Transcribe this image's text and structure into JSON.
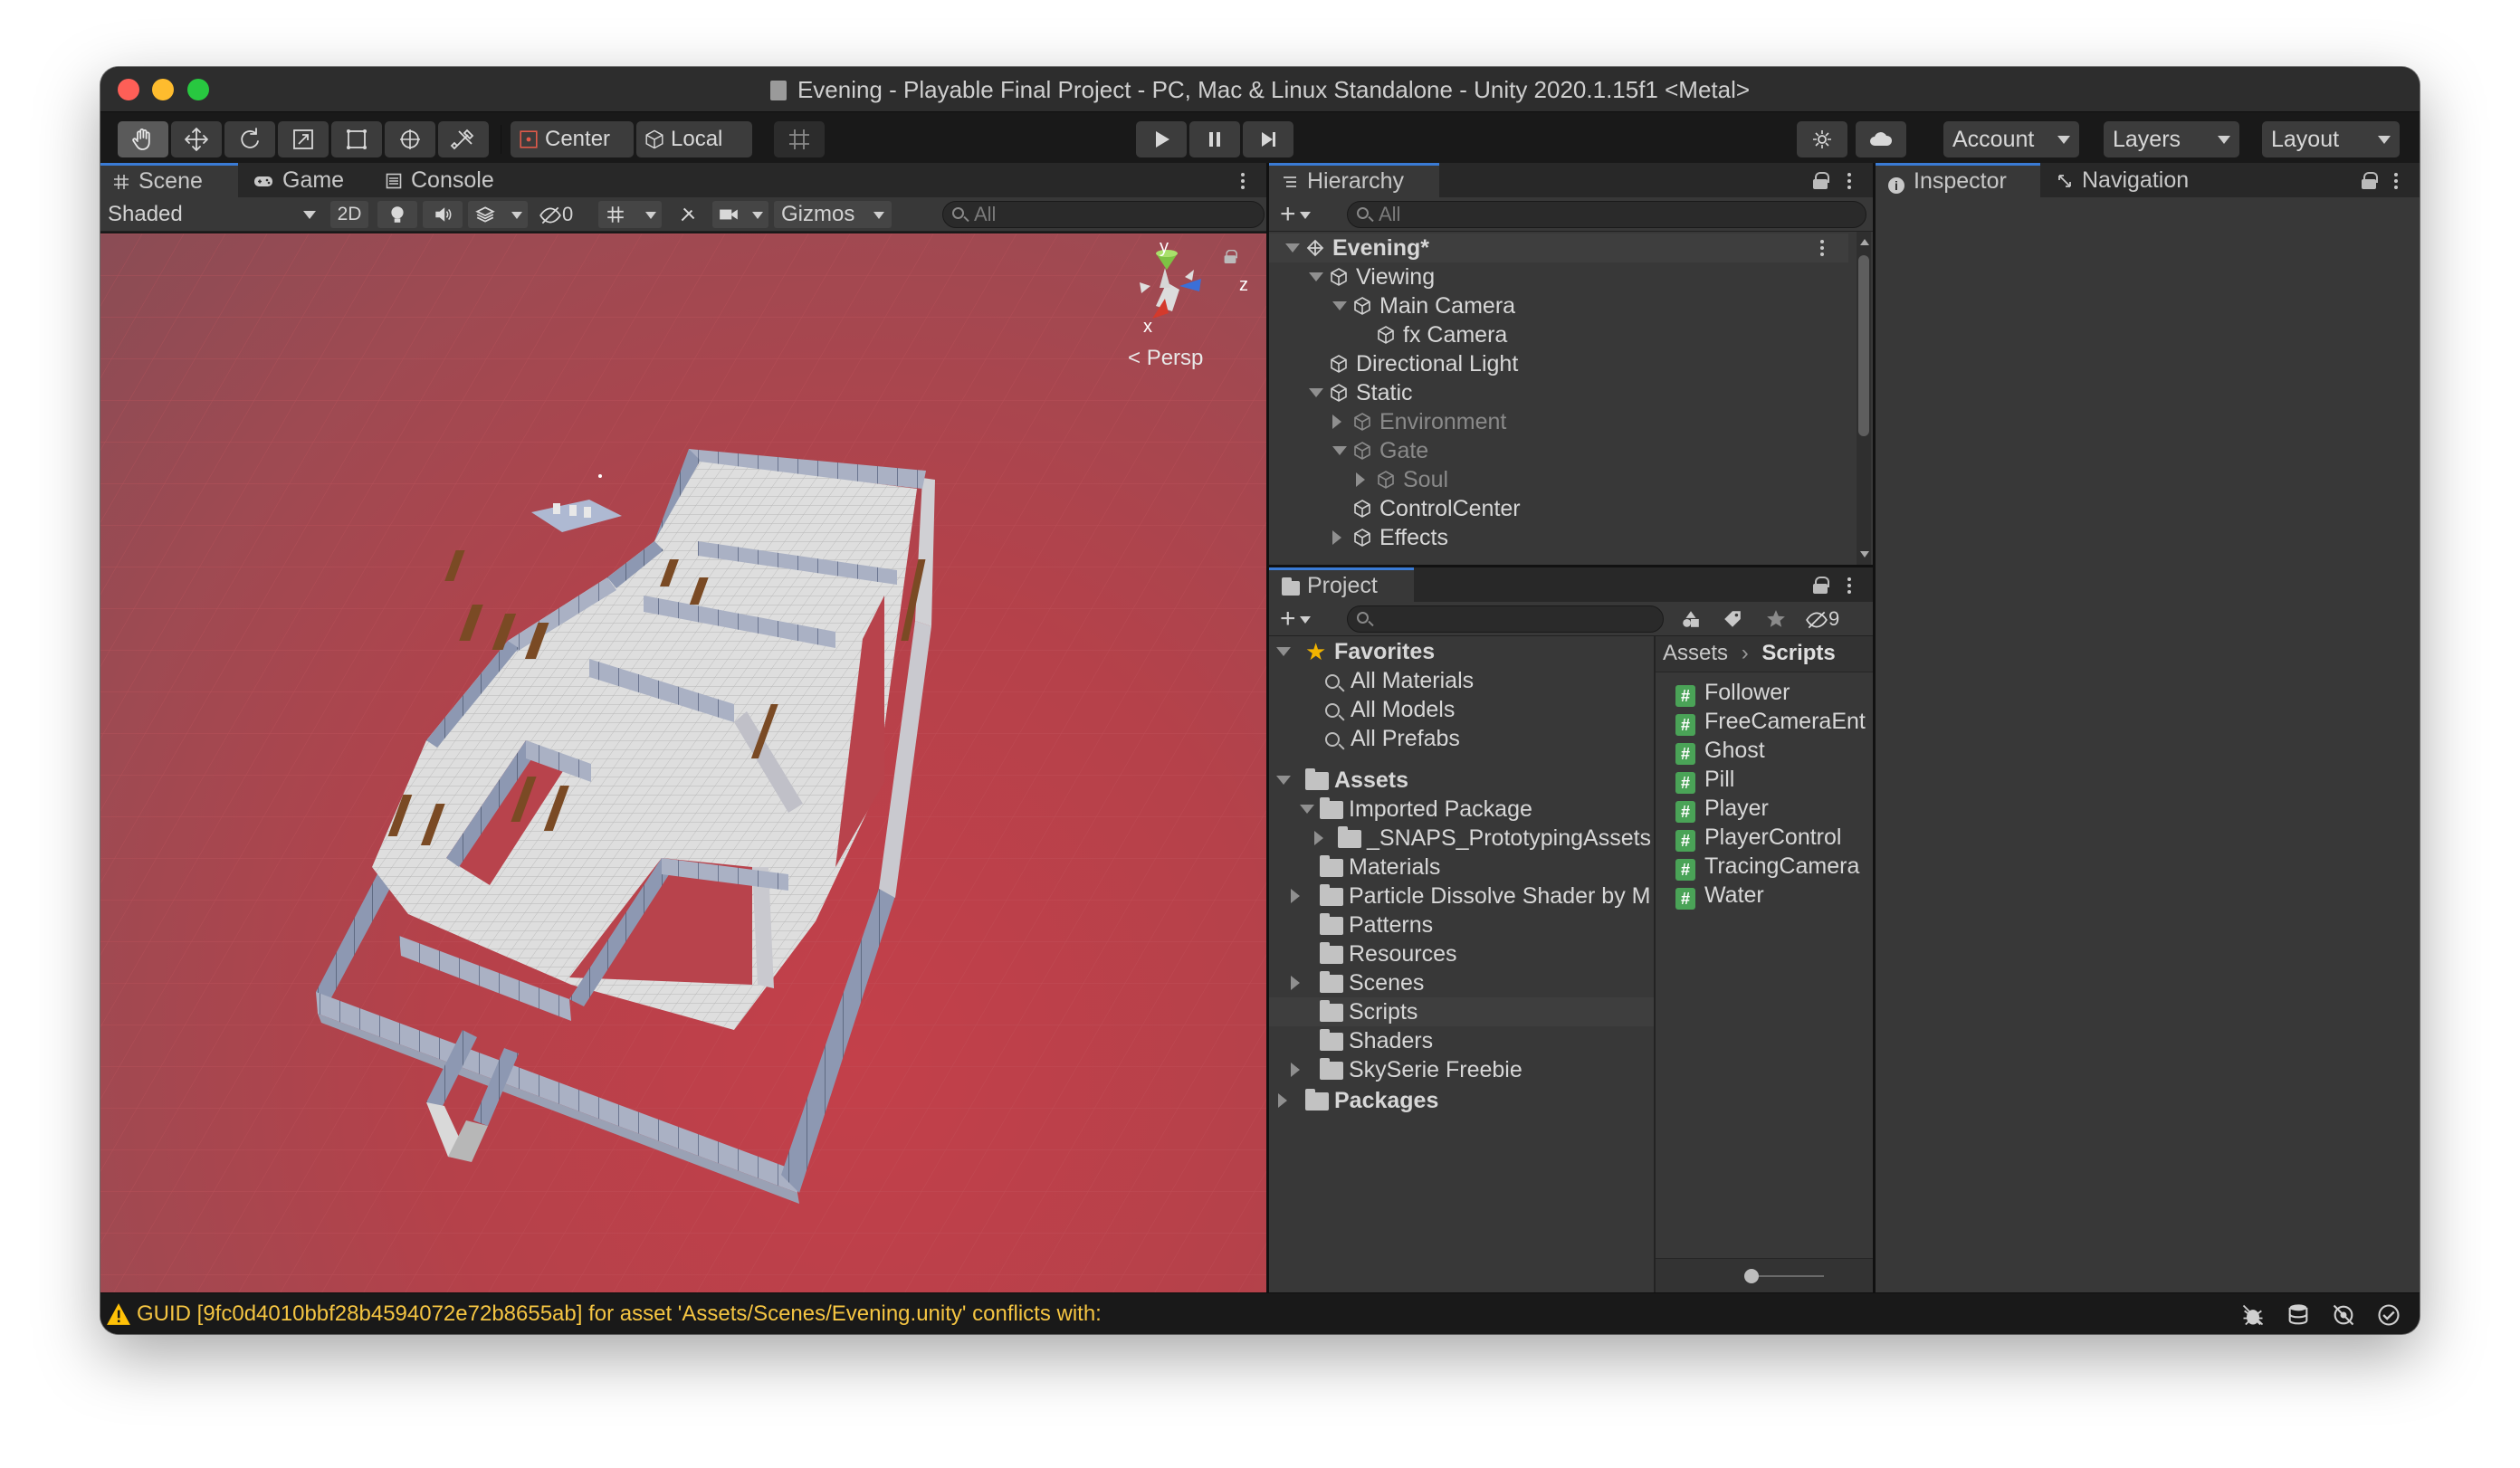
{
  "window": {
    "title": "Evening - Playable Final Project - PC, Mac & Linux Standalone - Unity 2020.1.15f1 <Metal>"
  },
  "colors": {
    "close": "#fe5f57",
    "minimize": "#febc2e",
    "zoom": "#28c840",
    "accent": "#3a7bd5",
    "selection": "#3e3e3e",
    "warning": "#ffc107",
    "scene_floor": "#b5414a"
  },
  "toolbar": {
    "tools": [
      "hand-tool",
      "move-tool",
      "rotate-tool",
      "scale-tool",
      "rect-tool",
      "transform-tool",
      "custom-tool"
    ],
    "pivot_label": "Center",
    "space_label": "Local",
    "play_controls": [
      "play",
      "pause",
      "step"
    ],
    "account_label": "Account",
    "layers_label": "Layers",
    "layout_label": "Layout"
  },
  "scene_panel": {
    "tabs": [
      {
        "label": "Scene",
        "icon": "grid-icon",
        "active": true
      },
      {
        "label": "Game",
        "icon": "gamepad-icon",
        "active": false
      },
      {
        "label": "Console",
        "icon": "console-icon",
        "active": false
      }
    ],
    "draw_mode": "Shaded",
    "mode_2d": "2D",
    "hidden_count": "0",
    "gizmos_label": "Gizmos",
    "search_placeholder": "All",
    "gizmo": {
      "y": "y",
      "z": "z",
      "x": "x",
      "projection": "Persp"
    }
  },
  "hierarchy": {
    "tab_label": "Hierarchy",
    "search_placeholder": "All",
    "items": [
      {
        "label": "Evening*",
        "depth": 0,
        "expanded": true,
        "type": "scene",
        "selected": true
      },
      {
        "label": "Viewing",
        "depth": 1,
        "expanded": true,
        "type": "object"
      },
      {
        "label": "Main Camera",
        "depth": 2,
        "expanded": true,
        "type": "object"
      },
      {
        "label": "fx Camera",
        "depth": 3,
        "type": "object"
      },
      {
        "label": "Directional Light",
        "depth": 1,
        "type": "object"
      },
      {
        "label": "Static",
        "depth": 1,
        "expanded": true,
        "type": "object"
      },
      {
        "label": "Environment",
        "depth": 2,
        "expanded": false,
        "type": "object",
        "disabled": true
      },
      {
        "label": "Gate",
        "depth": 2,
        "expanded": true,
        "type": "object",
        "disabled": true
      },
      {
        "label": "Soul",
        "depth": 3,
        "expanded": false,
        "type": "object",
        "disabled": true
      },
      {
        "label": "ControlCenter",
        "depth": 2,
        "type": "object"
      },
      {
        "label": "Effects",
        "depth": 2,
        "expanded": false,
        "type": "object"
      }
    ]
  },
  "project": {
    "tab_label": "Project",
    "hidden_count": "9",
    "favorites_label": "Favorites",
    "favorites": [
      "All Materials",
      "All Models",
      "All Prefabs"
    ],
    "assets_label": "Assets",
    "imported_package_label": "Imported Package",
    "tree": [
      {
        "label": "_SNAPS_PrototypingAssets",
        "depth": 2,
        "expandable": true
      },
      {
        "label": "Materials",
        "depth": 1,
        "expandable": false
      },
      {
        "label": "Particle Dissolve Shader by M",
        "depth": 1,
        "expandable": true
      },
      {
        "label": "Patterns",
        "depth": 1,
        "expandable": false
      },
      {
        "label": "Resources",
        "depth": 1,
        "expandable": false
      },
      {
        "label": "Scenes",
        "depth": 1,
        "expandable": true
      },
      {
        "label": "Scripts",
        "depth": 1,
        "expandable": false,
        "selected": true
      },
      {
        "label": "Shaders",
        "depth": 1,
        "expandable": false
      },
      {
        "label": "SkySerie Freebie",
        "depth": 1,
        "expandable": true
      }
    ],
    "packages_label": "Packages",
    "breadcrumb": [
      "Assets",
      "Scripts"
    ],
    "files": [
      "Follower",
      "FreeCameraEnt",
      "Ghost",
      "Pill",
      "Player",
      "PlayerControl",
      "TracingCamera",
      "Water"
    ]
  },
  "inspector": {
    "tabs": [
      {
        "label": "Inspector",
        "icon": "info-icon"
      },
      {
        "label": "Navigation",
        "icon": "navigation-icon"
      }
    ]
  },
  "status": {
    "message": "GUID [9fc0d4010bbf28b4594072e72b8655ab] for asset 'Assets/Scenes/Evening.unity' conflicts with:"
  }
}
